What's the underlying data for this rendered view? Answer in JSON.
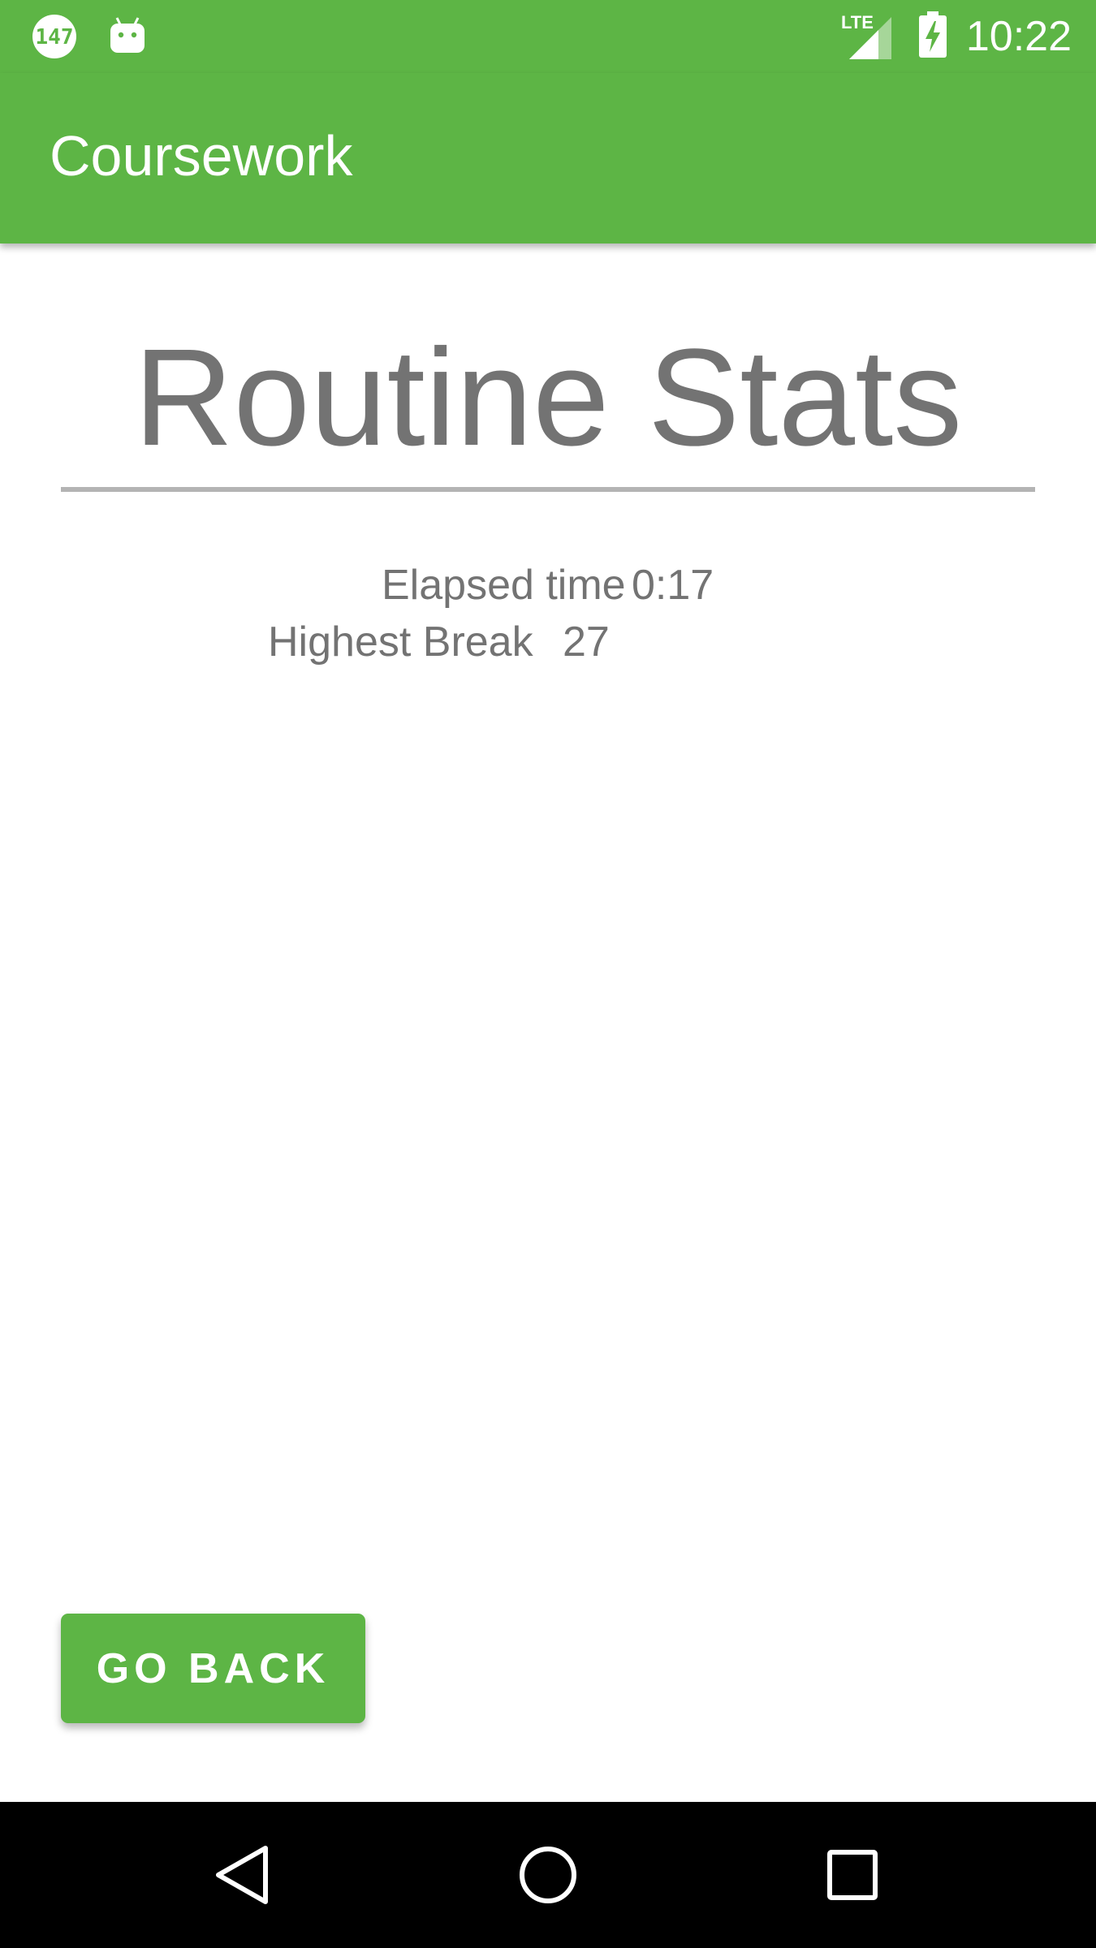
{
  "status_bar": {
    "notification_badge": "147",
    "time": "10:22",
    "network_label": "LTE",
    "icons": [
      "notification-counter-icon",
      "android-debug-icon",
      "lte-signal-icon",
      "battery-charging-icon"
    ],
    "background_color": "#5db545"
  },
  "app_bar": {
    "title": "Coursework",
    "background_color": "#5db545"
  },
  "main": {
    "heading": "Routine Stats",
    "stats": [
      {
        "label": "Elapsed time",
        "value": "0:17"
      },
      {
        "label": "Highest Break",
        "value": "27"
      }
    ],
    "text_color": "#737373"
  },
  "actions": {
    "go_back_label": "GO BACK"
  },
  "navigation_bar": {
    "buttons": [
      "back-icon",
      "home-icon",
      "recents-icon"
    ]
  }
}
